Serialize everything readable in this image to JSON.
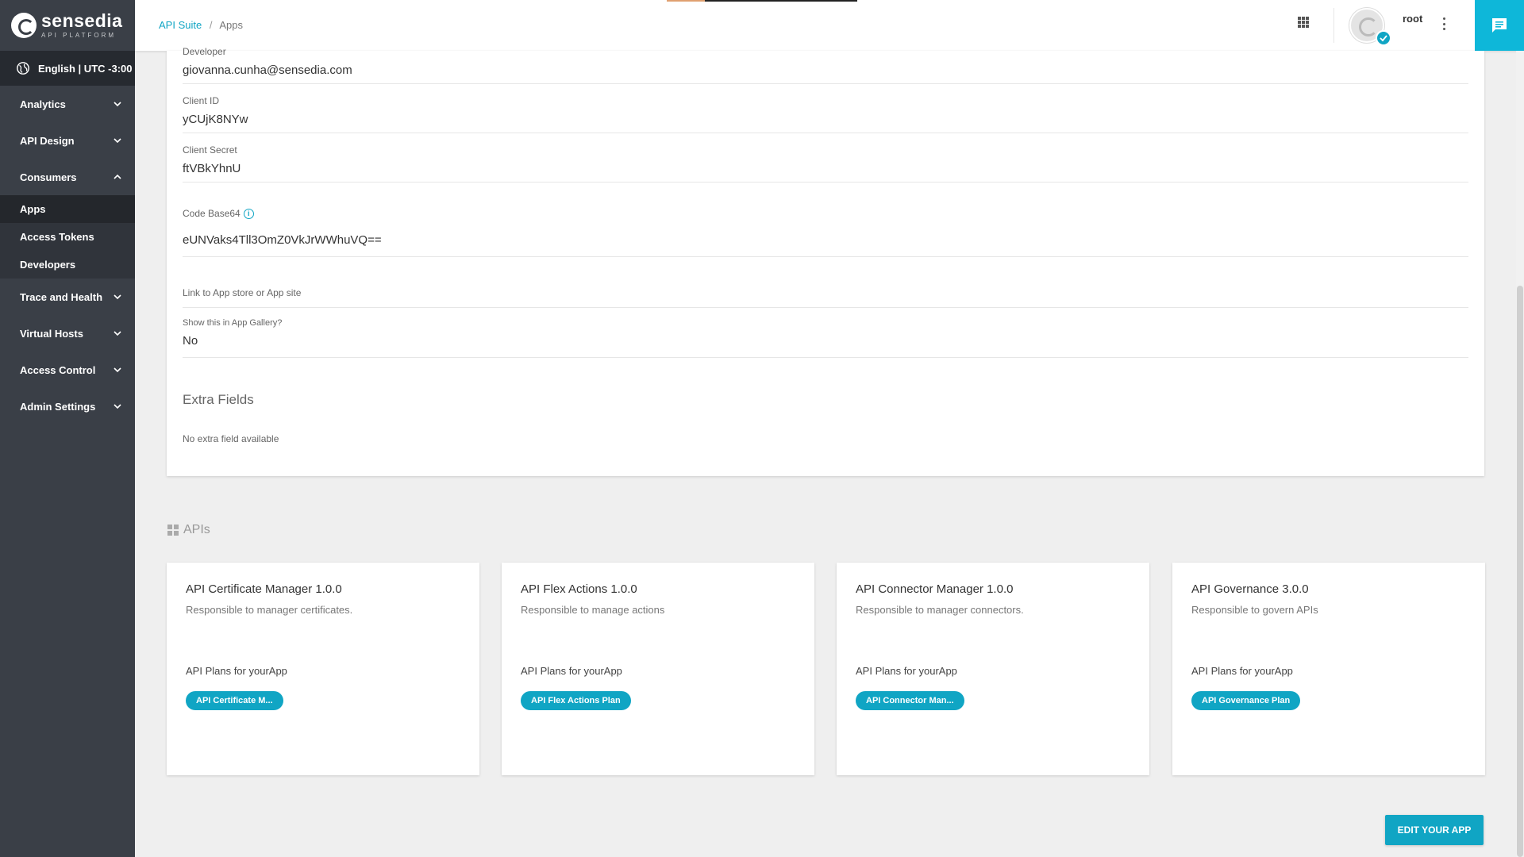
{
  "brand": {
    "name": "sensedia",
    "subtitle": "API PLATFORM"
  },
  "locale": {
    "label": "English | UTC -3:00"
  },
  "sidebar": {
    "items": [
      {
        "label": "Analytics",
        "expanded": false
      },
      {
        "label": "API Design",
        "expanded": false
      },
      {
        "label": "Consumers",
        "expanded": true,
        "children": [
          "Apps",
          "Access Tokens",
          "Developers"
        ]
      },
      {
        "label": "Trace and Health",
        "expanded": false
      },
      {
        "label": "Virtual Hosts",
        "expanded": false
      },
      {
        "label": "Access Control",
        "expanded": false
      },
      {
        "label": "Admin Settings",
        "expanded": false
      }
    ],
    "active_child": "Apps"
  },
  "header": {
    "breadcrumb": {
      "root": "API Suite",
      "separator": "/",
      "current": "Apps"
    },
    "username": "root",
    "icons": [
      "apps-grid-icon",
      "avatar",
      "verified-check-icon",
      "more-vert-icon",
      "chat-icon"
    ]
  },
  "details": {
    "developer": {
      "label": "Developer",
      "value": "giovanna.cunha@sensedia.com"
    },
    "client_id": {
      "label": "Client ID",
      "value": "yCUjK8NYw"
    },
    "client_secret": {
      "label": "Client Secret",
      "value": "ftVBkYhnU"
    },
    "code_base64": {
      "label": "Code Base64",
      "value": "eUNVaks4Tll3OmZ0VkJrWWhuVQ==",
      "info_glyph": "i"
    },
    "app_link": {
      "label": "Link to App store or App site",
      "value": ""
    },
    "gallery": {
      "label": "Show this in App Gallery?",
      "value": "No"
    },
    "extra_fields": {
      "title": "Extra Fields",
      "empty_text": "No extra field available"
    }
  },
  "apis": {
    "title": "APIs",
    "cards": [
      {
        "title": "API Certificate Manager 1.0.0",
        "description": "Responsible to manager certificates.",
        "plans_label": "API Plans for yourApp",
        "plan": "API Certificate M..."
      },
      {
        "title": "API Flex Actions 1.0.0",
        "description": "Responsible to manage actions",
        "plans_label": "API Plans for yourApp",
        "plan": "API Flex Actions Plan"
      },
      {
        "title": "API Connector Manager 1.0.0",
        "description": "Responsible to manager connectors.",
        "plans_label": "API Plans for yourApp",
        "plan": "API Connector Man..."
      },
      {
        "title": "API Governance 3.0.0",
        "description": "Responsible to govern APIs",
        "plans_label": "API Plans for yourApp",
        "plan": "API Governance Plan"
      }
    ]
  },
  "actions": {
    "edit_label": "EDIT YOUR APP"
  },
  "colors": {
    "accent": "#10a5c4",
    "chat": "#0eb7d9",
    "sidebar_bg": "#3a3f47",
    "sidebar_dark": "#262a30"
  }
}
